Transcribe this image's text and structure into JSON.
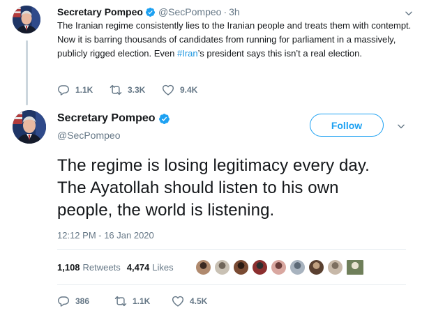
{
  "parent_tweet": {
    "author_name": "Secretary Pompeo",
    "handle": "@SecPompeo",
    "separator": "·",
    "time": "3h",
    "text_before": "The Iranian regime consistently lies to the Iranian people and treats them with contempt. Now it is barring thousands of candidates from running for parliament in a massively, publicly rigged election. Even ",
    "hashtag": "#Iran",
    "text_after": "’s president says this isn’t a real election.",
    "replies": "1.1K",
    "retweets": "3.3K",
    "likes": "9.4K",
    "icons": [
      "avatar",
      "verified-badge-icon",
      "chevron-down-icon",
      "reply-icon",
      "retweet-icon",
      "like-icon"
    ]
  },
  "main_tweet": {
    "author_name": "Secretary Pompeo",
    "handle": "@SecPompeo",
    "follow_label": "Follow",
    "text": "The regime is losing legitimacy every day. The Ayatollah should listen to his own people, the world is listening.",
    "timestamp": "12:12 PM - 16 Jan 2020",
    "retweet_count": "1,108",
    "retweet_label": "Retweets",
    "like_count": "4,474",
    "like_label": "Likes",
    "replies": "386",
    "retweets": "1.1K",
    "likes": "4.5K",
    "liker_avatar_count": 9,
    "icons": [
      "avatar",
      "verified-badge-icon",
      "chevron-down-icon",
      "reply-icon",
      "retweet-icon",
      "like-icon"
    ]
  },
  "colors": {
    "accent": "#1da1f2",
    "hashtag": "#1b95e0",
    "text": "#14171a",
    "muted": "#657786",
    "divider": "#e6ecf0",
    "thread_line": "#ccd6dd"
  }
}
